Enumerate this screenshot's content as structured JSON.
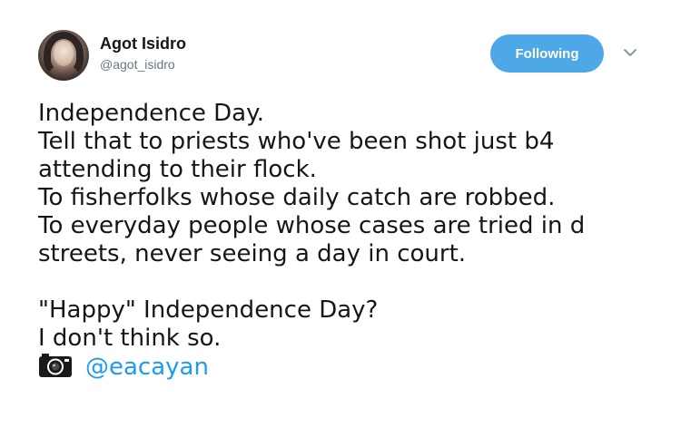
{
  "author": {
    "name": "Agot Isidro",
    "handle": "@agot_isidro"
  },
  "follow_button": {
    "label": "Following",
    "color": "#4ea8e8"
  },
  "menu_icon": "chevron-down-icon",
  "tweet": {
    "lines": [
      "Independence Day.",
      "Tell that to priests who've been shot just b4",
      "attending to their flock.",
      "To fisherfolks whose daily catch are robbed.",
      "To everyday people whose cases are tried in d",
      "streets, never seeing a day in court."
    ],
    "lines2": [
      "\"Happy\" Independence Day?",
      "I don't think so."
    ],
    "photo_credit_icon": "camera-icon",
    "photo_credit_mention": "@eacayan",
    "mention_color": "#1d9bf0"
  }
}
